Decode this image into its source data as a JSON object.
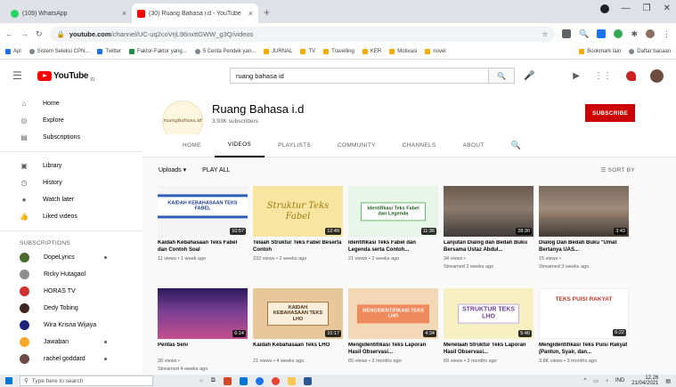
{
  "browser": {
    "tabs": [
      {
        "title": "(109) WhatsApp",
        "icon": "whatsapp-icon",
        "active": false
      },
      {
        "title": "(30) Ruang Bahasa i.d - YouTube",
        "icon": "youtube-icon",
        "active": true
      }
    ],
    "url_host": "youtube.com",
    "url_path": "/channel/UC-uq2coVrjL96nxttGWW_g3Q/videos",
    "bookmarks": [
      "Apl",
      "Sistem Seleksi CPN...",
      "Twitter",
      "Faktor-Faktor yang...",
      "5 Cerita Pendek yan...",
      "JURNAL",
      "TV",
      "Travelling",
      "KER",
      "Motivasi",
      "novel"
    ],
    "bookmarks_right": [
      "Bookmark lain",
      "Daftar bacaan"
    ]
  },
  "youtube": {
    "logo_text": "YouTube",
    "country_code": "ID",
    "search_query": "ruang bahasa id"
  },
  "sidebar": {
    "main": [
      {
        "label": "Home",
        "icon": "home-icon"
      },
      {
        "label": "Explore",
        "icon": "compass-icon"
      },
      {
        "label": "Subscriptions",
        "icon": "subscriptions-icon"
      }
    ],
    "library": [
      {
        "label": "Library",
        "icon": "library-icon"
      },
      {
        "label": "History",
        "icon": "history-icon"
      },
      {
        "label": "Watch later",
        "icon": "clock-icon"
      },
      {
        "label": "Liked videos",
        "icon": "thumbs-up-icon"
      }
    ],
    "subscriptions_heading": "SUBSCRIPTIONS",
    "subscriptions": [
      {
        "label": "DopeLyrics",
        "color": "#4a6b2f",
        "live": true
      },
      {
        "label": "Ricky Hutagaol",
        "color": "#8e8e8e",
        "live": false
      },
      {
        "label": "HORAS TV",
        "color": "#d32f2f",
        "live": false
      },
      {
        "label": "Dedy Tobing",
        "color": "#3e2723",
        "live": false
      },
      {
        "label": "Wira Krisna Wijaya",
        "color": "#1a237e",
        "live": false
      },
      {
        "label": "Jawaban",
        "color": "#f9a825",
        "live": true
      },
      {
        "label": "rachel goddard",
        "color": "#6d4c41",
        "live": true
      }
    ]
  },
  "channel": {
    "logo_text": "ruangbahasa.id",
    "name": "Ruang Bahasa i.d",
    "subscribers": "3.93K subscribers",
    "subscribe_label": "SUBSCRIBE",
    "tabs": [
      "HOME",
      "VIDEOS",
      "PLAYLISTS",
      "COMMUNITY",
      "CHANNELS",
      "ABOUT"
    ],
    "active_tab": "VIDEOS",
    "uploads_label": "Uploads",
    "play_all_label": "PLAY ALL",
    "sort_label": "SORT BY"
  },
  "videos": [
    {
      "title": "Kaidah Kebahasaan Teks Fabel dan Contoh Soal",
      "meta1": "11 views • 1 week ago",
      "meta2": "",
      "duration": "10:57",
      "thumb_text": "KAIDAH KEBAHASAAN TEKS FABEL"
    },
    {
      "title": "Telaah Struktur Teks Fabel Beserta Contoh",
      "meta1": "232 views • 2 weeks ago",
      "meta2": "",
      "duration": "12:49",
      "thumb_text": "Struktur Teks Fabel"
    },
    {
      "title": "Identifikasi Teks Fabel dan Legenda serta Contoh...",
      "meta1": "21 views • 2 weeks ago",
      "meta2": "",
      "duration": "11:36",
      "thumb_text": "Identifikasi Teks Fabel dan Legenda"
    },
    {
      "title": "Lanjutan Dialog dan Bedah Buku Bersama Ustaz Abdul...",
      "meta1": "34 views •",
      "meta2": "Streamed 3 weeks ago",
      "duration": "28:30",
      "thumb_text": ""
    },
    {
      "title": "Dialog Dan Bedah Buku \"Umat Bertanya UAS...",
      "meta1": "15 views •",
      "meta2": "Streamed 3 weeks ago",
      "duration": "3:43",
      "thumb_text": ""
    },
    {
      "title": "Pentas Seni",
      "meta1": "28 views •",
      "meta2": "Streamed 4 weeks ago",
      "duration": "6:14",
      "thumb_text": ""
    },
    {
      "title": "Kaidah Kebahasaan Teks LHO",
      "meta1": "21 views • 4 weeks ago",
      "meta2": "",
      "duration": "10:17",
      "thumb_text": "KAIDAH KEBAHASAAN TEKS LHO"
    },
    {
      "title": "Mengidentifikasi Teks Laporan Hasil Observasi...",
      "meta1": "65 views • 3 months ago",
      "meta2": "",
      "duration": "4:34",
      "thumb_text": "MENGIDENTIFIKASI TEKS LHO"
    },
    {
      "title": "Menelaah Struktur Teks Laporan Hasil Observasi...",
      "meta1": "69 views • 3 months ago",
      "meta2": "",
      "duration": "5:40",
      "thumb_text": "STRUKTUR TEKS LHO"
    },
    {
      "title": "Mengidentifikasi Teks Puisi Rakyat (Pantun, Syair, dan...",
      "meta1": "3.8K views • 3 months ago",
      "meta2": "",
      "duration": "6:22",
      "thumb_text": "TEKS PUISI RAKYAT"
    }
  ],
  "taskbar": {
    "search_placeholder": "Type here to search",
    "language": "IND",
    "time": "12.26",
    "date": "21/04/2021"
  }
}
